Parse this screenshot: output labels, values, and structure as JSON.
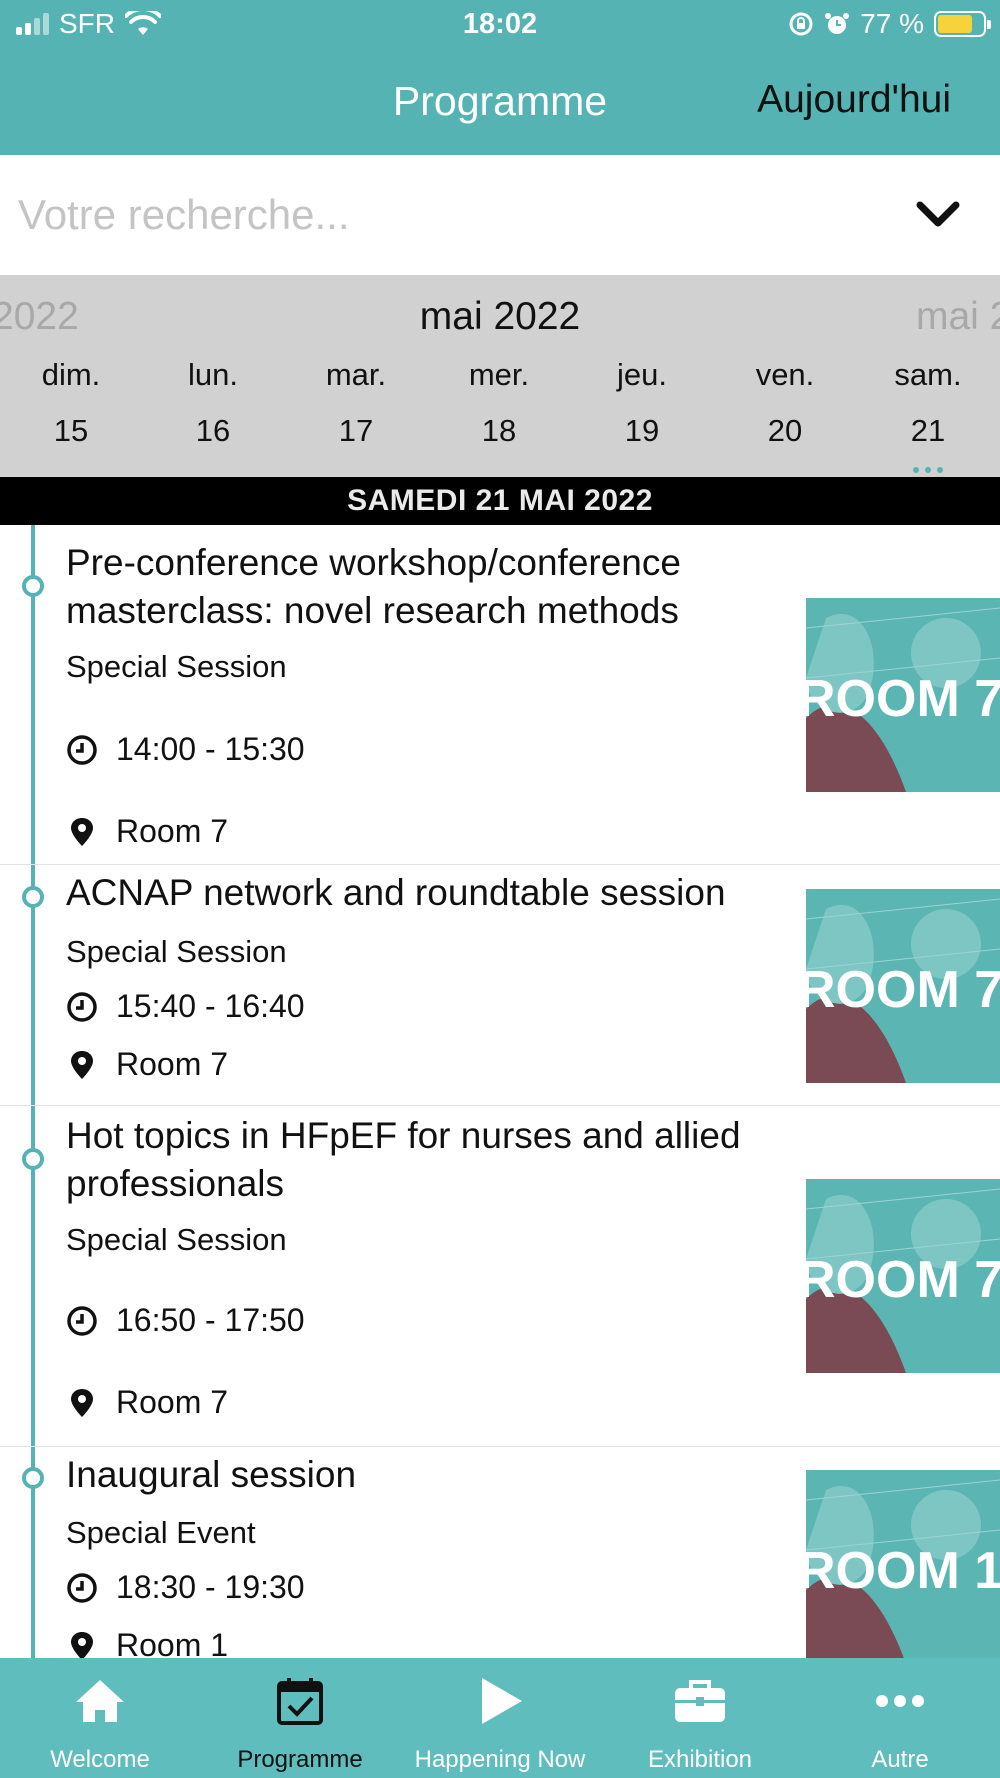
{
  "status_bar": {
    "carrier": "SFR",
    "time": "18:02",
    "battery_text": "77 %",
    "battery_level": 0.77,
    "icons": [
      "signal-icon",
      "wifi-icon",
      "orientation-lock-icon",
      "alarm-icon",
      "battery-charging-icon"
    ]
  },
  "nav": {
    "title": "Programme",
    "today_button": "Aujourd'hui"
  },
  "search": {
    "placeholder": "Votre recherche...",
    "value": ""
  },
  "calendar": {
    "prev_month": "2022",
    "current_month": "mai 2022",
    "next_month": "mai 2",
    "days": [
      {
        "name": "dim.",
        "date": "15"
      },
      {
        "name": "lun.",
        "date": "16"
      },
      {
        "name": "mar.",
        "date": "17"
      },
      {
        "name": "mer.",
        "date": "18"
      },
      {
        "name": "jeu.",
        "date": "19"
      },
      {
        "name": "ven.",
        "date": "20"
      },
      {
        "name": "sam.",
        "date": "21"
      }
    ],
    "selected_date": "21"
  },
  "day_header": "SAMEDI 21 MAI 2022",
  "sessions": [
    {
      "title": "Pre-conference workshop/conference masterclass: novel research methods",
      "type": "Special Session",
      "time": "14:00 - 15:30",
      "room": "Room 7",
      "thumb_text": "ROOM 7"
    },
    {
      "title": "ACNAP network and roundtable session",
      "type": "Special Session",
      "time": "15:40 - 16:40",
      "room": "Room 7",
      "thumb_text": "ROOM 7"
    },
    {
      "title": "Hot topics in HFpEF for nurses and allied professionals",
      "type": "Special Session",
      "time": "16:50 - 17:50",
      "room": "Room 7",
      "thumb_text": "ROOM 7"
    },
    {
      "title": "Inaugural session",
      "type": "Special Event",
      "time": "18:30 - 19:30",
      "room": "Room 1",
      "thumb_text": "ROOM 1"
    }
  ],
  "tabbar": {
    "items": [
      {
        "label": "Welcome",
        "icon": "home-icon"
      },
      {
        "label": "Programme",
        "icon": "calendar-check-icon",
        "active": true
      },
      {
        "label": "Happening Now",
        "icon": "play-icon"
      },
      {
        "label": "Exhibition",
        "icon": "briefcase-icon"
      },
      {
        "label": "Autre",
        "icon": "more-icon"
      }
    ]
  },
  "colors": {
    "accent": "#56b3b3",
    "tabbar": "#5fbdbd",
    "calendar_bg": "#d1d1d1",
    "day_header_bg": "#000000",
    "thumb_shape": "#7a4a55"
  }
}
